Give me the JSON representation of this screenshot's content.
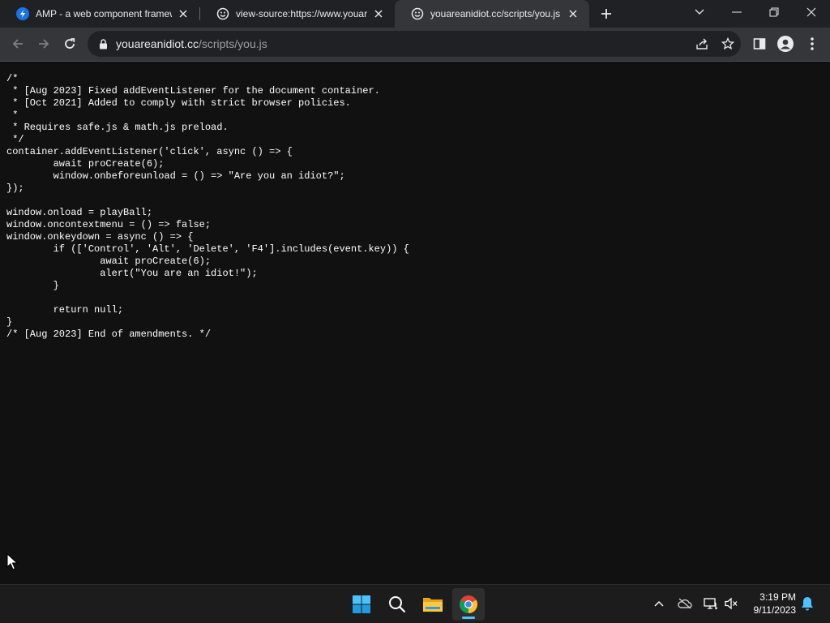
{
  "browser": {
    "tabs": [
      {
        "title": "AMP - a web component framew",
        "favicon": "amp-icon",
        "active": false
      },
      {
        "title": "view-source:https://www.youare",
        "favicon": "smiley-icon",
        "active": false
      },
      {
        "title": "youareanidiot.cc/scripts/you.js",
        "favicon": "smiley-icon",
        "active": true
      }
    ],
    "url_host": "youareanidiot.cc",
    "url_path": "/scripts/you.js"
  },
  "page": {
    "code": "/*\n * [Aug 2023] Fixed addEventListener for the document container.\n * [Oct 2021] Added to comply with strict browser policies.\n *\n * Requires safe.js & math.js preload.\n */\ncontainer.addEventListener('click', async () => {\n\tawait proCreate(6);\n\twindow.onbeforeunload = () => \"Are you an idiot?\";\n});\n\nwindow.onload = playBall;\nwindow.oncontextmenu = () => false;\nwindow.onkeydown = async () => {\n\tif (['Control', 'Alt', 'Delete', 'F4'].includes(event.key)) {\n\t\tawait proCreate(6);\n\t\talert(\"You are an idiot!\");\n\t}\n\n\treturn null;\n}\n/* [Aug 2023] End of amendments. */"
  },
  "taskbar": {
    "time": "3:19 PM",
    "date": "9/11/2023",
    "apps": [
      "start-icon",
      "search-icon",
      "file-explorer-icon",
      "chrome-icon"
    ]
  },
  "colors": {
    "page_background": "#111111",
    "tabstrip": "#202124",
    "toolbar": "#35363a",
    "accent": "#4cc2ff"
  }
}
